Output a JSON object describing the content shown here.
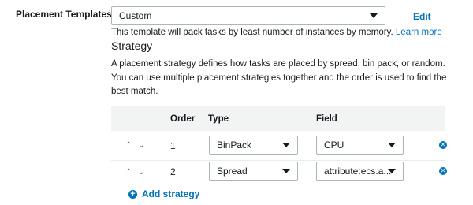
{
  "placement": {
    "label": "Placement Templates",
    "selected": "Custom",
    "edit_link": "Edit",
    "description": "This template will pack tasks by least number of instances by memory.",
    "learn_more": "Learn more"
  },
  "strategy": {
    "title": "Strategy",
    "paragraph": "A placement strategy defines how tasks are placed by spread, bin pack, or random. You can use multiple placement strategies together and the order is used to find the best match."
  },
  "table": {
    "headers": {
      "order": "Order",
      "type": "Type",
      "field": "Field"
    },
    "rows": [
      {
        "order": "1",
        "type": "BinPack",
        "field": "CPU"
      },
      {
        "order": "2",
        "type": "Spread",
        "field": "attribute:ecs.a..."
      }
    ]
  },
  "icons": {
    "move_up": "chevron-up-icon",
    "move_down": "chevron-down-icon",
    "remove": "remove-circle-icon",
    "add": "add-circle-icon"
  },
  "add_strategy": "Add strategy",
  "colors": {
    "link": "#0073bb",
    "header_bg": "#f2f3f3"
  }
}
